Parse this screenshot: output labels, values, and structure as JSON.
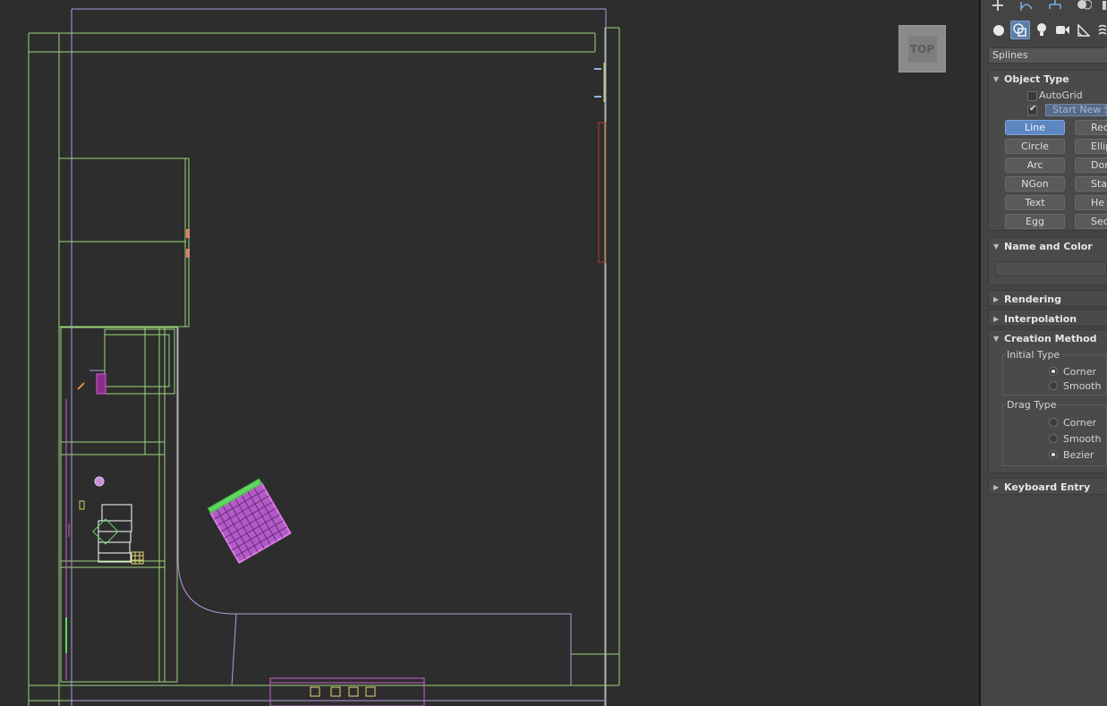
{
  "viewport": {
    "view_label": "TOP",
    "colors": {
      "background": "#2d2d2d",
      "wall": "#9bd67a",
      "floor": "#b49be0",
      "selected": "#d25cd2",
      "accent_red": "#b23c3c"
    }
  },
  "panel": {
    "category_dropdown": "Splines",
    "object_type": {
      "title": "Object Type",
      "autogrid_label": "AutoGrid",
      "autogrid_checked": false,
      "start_new_shape_label": "Start New Sh",
      "start_new_shape_checked": true,
      "buttons": [
        {
          "label": "Line",
          "active": true
        },
        {
          "label": "Recta",
          "active": false
        },
        {
          "label": "Circle",
          "active": false
        },
        {
          "label": "Ellip",
          "active": false
        },
        {
          "label": "Arc",
          "active": false
        },
        {
          "label": "Don",
          "active": false
        },
        {
          "label": "NGon",
          "active": false
        },
        {
          "label": "Sta",
          "active": false
        },
        {
          "label": "Text",
          "active": false
        },
        {
          "label": "He",
          "active": false
        },
        {
          "label": "Egg",
          "active": false
        },
        {
          "label": "Sect",
          "active": false
        }
      ]
    },
    "name_and_color": {
      "title": "Name and Color",
      "name_value": ""
    },
    "rendering": {
      "title": "Rendering"
    },
    "interpolation": {
      "title": "Interpolation"
    },
    "creation_method": {
      "title": "Creation Method",
      "initial_type": {
        "title": "Initial Type",
        "options": [
          "Corner",
          "Smooth"
        ],
        "selected": "Corner"
      },
      "drag_type": {
        "title": "Drag Type",
        "options": [
          "Corner",
          "Smooth",
          "Bezier"
        ],
        "selected": "Bezier"
      }
    },
    "keyboard_entry": {
      "title": "Keyboard Entry"
    },
    "icons": {
      "top_row": [
        "create-icon",
        "modify-icon",
        "hierarchy-icon",
        "motion-icon"
      ],
      "category_row": [
        "geometry-icon",
        "shapes-icon",
        "lights-icon",
        "cameras-icon",
        "helpers-icon",
        "spacewarps-icon"
      ]
    }
  }
}
